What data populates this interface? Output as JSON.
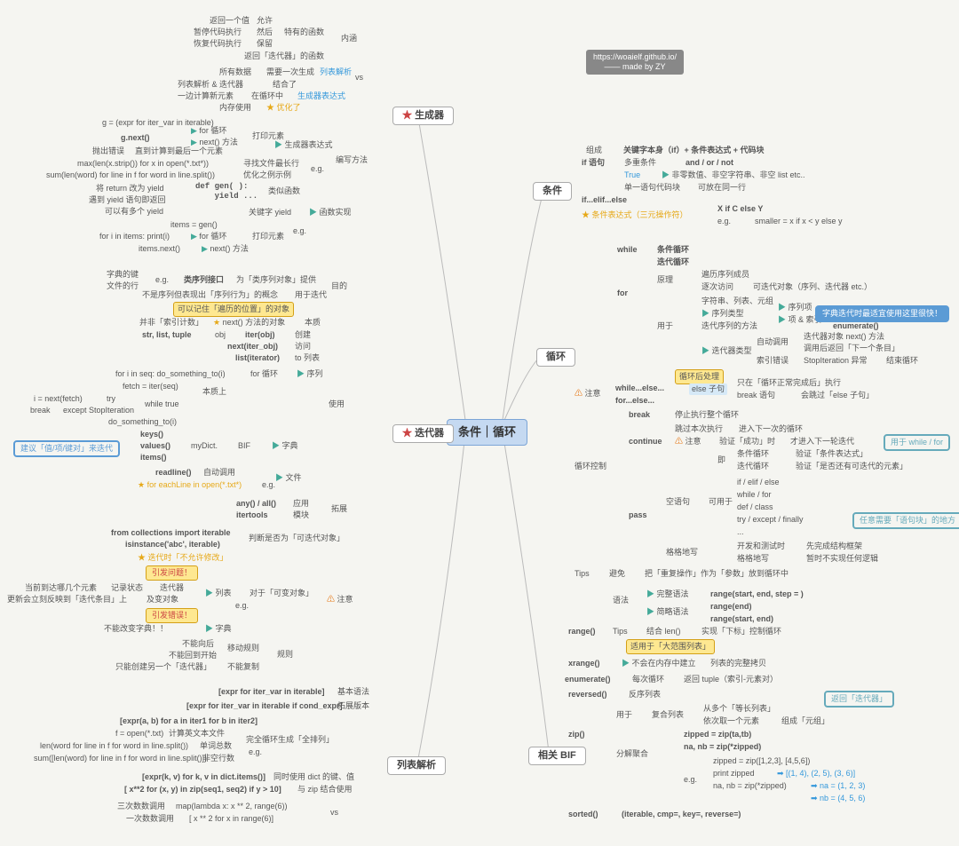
{
  "central": "条件｜循环",
  "credit": {
    "l1": "https://woaielf.github.io/",
    "l2": "—— made by ZY"
  },
  "cats": {
    "gen": "生成器",
    "iter": "迭代器",
    "list": "列表解析",
    "cond": "条件",
    "loop": "循环",
    "bif": "相关 BIF"
  },
  "gen": {
    "ret": "返回一个值",
    "allow": "允许",
    "pause": "暂停代码执行",
    "then": "然后",
    "spec": "特有的函数",
    "resume": "恢复代码执行",
    "keep": "保留",
    "neirun": "内涵",
    "retlist": "返回「迭代器」的函数",
    "all": "所有数据",
    "once": "需要一次生成",
    "listp": "列表解析",
    "parse": "列表解析 & 迭代器",
    "comb": "结合了",
    "vs": "vs",
    "onecalc": "一边计算新元素",
    "inloop": "在循环中",
    "genexpr": "生成器表达式",
    "mem": "内存使用",
    "opt": "★ 优化了",
    "gexpr": "g = (expr for iter_var in iterable)",
    "gnext": "g.next()",
    "forloop": "for 循环",
    "nextm": "next() 方法",
    "print": "打印元素",
    "throw": "抛出错误",
    "tolast": "直到计算到最后一个元素",
    "genexprn": "生成器表达式",
    "maxlen": "max(len(x.strip()) for x in open(*.txt*))",
    "findmax": "寻找文件最长行",
    "eg": "e.g.",
    "sumlen": "sum(len(word) for line in f for word in line.split())",
    "optex": "优化之例示例",
    "writem": "编写方法",
    "retyield": "将 return 改为 yield",
    "defgen": "def gen( ):\\n    yield ...",
    "likefn": "类似函数",
    "yieldret": "遇到 yield 语句即返回",
    "multy": "可以有多个 yield",
    "kwyield": "关键字 yield",
    "fnimp": "函数实现",
    "items": "items = gen()",
    "fori": "for i in items: print(i)",
    "foriter": "for 循环",
    "printel": "打印元素",
    "itemsnext": "items.next()",
    "nextmm": "next() 方法"
  },
  "iter": {
    "dictk": "字典的键",
    "fileline": "文件的行",
    "eg": "e.g.",
    "seqif": "类序列接口",
    "forseq": "为「类序列对象」提供",
    "purpose": "目的",
    "notseq": "不是序列但表现出「序列行为」的概念",
    "useiter": "用于迭代",
    "remember": "可以记住「遍历的位置」的对象",
    "noidx": "并非「索引计数」",
    "nextobj": "next() 方法的对象",
    "essence": "本质",
    "types": "str, list, tuple",
    "obj": "obj",
    "iterobj": "iter(obj)",
    "create": "创建",
    "nextiter": "next(iter_obj)",
    "visit": "访问",
    "listiter": "list(iterator)",
    "tolist": "to 列表",
    "forseq2": "for i in seq: do_something_to(i)",
    "forloop": "for 循环",
    "seq": "序列",
    "fetch": "fetch = iter(seq)",
    "ess2": "本质上",
    "inext": "i = next(fetch)",
    "try": "try",
    "whiletrue": "while true",
    "use": "使用",
    "break": "break",
    "except": "except StopIteration",
    "dosth": "do_something_to(i)",
    "keys": "keys()",
    "values": "values()",
    "items": "items()",
    "mydict": "myDict.",
    "bif": "BIF",
    "dict": "字典",
    "readline": "readline()",
    "autocall": "自动调用",
    "file": "文件",
    "foreach": "★ for eachLine in open(*.txt*)",
    "eg2": "e.g.",
    "anyall": "any() / all()",
    "apply": "应用",
    "itertools": "itertools",
    "module": "模块",
    "extend": "拓展",
    "fromcol": "from collections import iterable",
    "isinst": "isinstance('abc', iterable)",
    "judge": "判断是否为「可迭代对象」",
    "iternomod": "★ 迭代时「不允许修改」",
    "problem": "引发问题！",
    "seehow": "当前到达哪几个元素",
    "recstate": "记录状态",
    "iterator": "迭代器",
    "list": "列表",
    "forvar": "对于「可变对象」",
    "newadd": "更新会立刻反映到「迭代条目」上",
    "onfly": "及变对象",
    "note": "注意",
    "eg3": "e.g.",
    "error": "引发错误！",
    "nomod": "不能改变字典！！",
    "dict2": "字典",
    "nomove": "不能向后",
    "moverule": "移动规则",
    "rule": "规则",
    "noback": "不能回到开始",
    "onlyone": "只能创建另一个「迭代器」",
    "nocopy": "不能复制",
    "recommend": "建议「值/项/键对」来迭代"
  },
  "list": {
    "basic": "[expr for iter_var in iterable]",
    "basicv": "基本语法",
    "cond": "[expr for iter_var in iterable if cond_expr]",
    "condv": "拓展版本",
    "nest": "[expr(a, b) for a in iter1 for b in iter2]",
    "fopen": "f = open(*.txt)",
    "calc": "计算英文本文件",
    "fullge": "完全循环生成「全排列」",
    "lenword": "len(word for line in f for word in line.split())",
    "wordcnt": "单词总数",
    "eg": "e.g.",
    "sumword": "sum([len(word) for line in f for word in line.split()])",
    "nonempty": "非空行数",
    "dictkv": "[expr(k, v) for k, v in dict.items()]",
    "usedict": "同时使用 dict 的键、值",
    "zip": "[ x**2 for (x, y) in zip(seq1, seq2) if y > 10]",
    "zipuse": "与 zip 结合使用",
    "map": "三次数数调用",
    "maplam": "map(lambda x: x ** 2, range(6))",
    "vs": "vs",
    "one": "一次数数调用",
    "onelam": "[ x ** 2 for x in range(6)]"
  },
  "cond": {
    "compose": "组成",
    "kw": "关键字本身（if）+ 条件表达式 + 代码块",
    "if": "if 语句",
    "multi": "多重条件",
    "andor": "and / or / not",
    "true": "True",
    "nonzero": "非零数值、非空字符串、非空 list etc..",
    "single": "单一语句代码块",
    "sameline": "可放在同一行",
    "elif": "if...elif...else",
    "ternary": "★ 条件表达式（三元操作符）",
    "xify": "X if C else Y",
    "eg": "e.g.",
    "smaller": "smaller = x if x < y else y"
  },
  "loop": {
    "while": "while",
    "condloop": "条件循环",
    "iterloop": "迭代循环",
    "principle": "原理",
    "iterseq": "遍历序列成员",
    "eachvisit": "逐次访问",
    "iterable": "可迭代对象（序列、迭代器 etc.）",
    "for": "for",
    "strtuple": "字符串、列表、元组",
    "seqtype": "序列类型",
    "byseq": "序列项",
    "iterseqm": "迭代序列的方法",
    "idx": "项 & 索引",
    "enum": "enumerate()",
    "usedfor": "用于",
    "itertype": "迭代器类型",
    "autocall": "自动调用",
    "nextm": "迭代器对象 next() 方法",
    "callret": "调用后返回「下一个条目」",
    "idxerr": "索引错误",
    "stopiter": "StopIteration 异常",
    "endloop": "结束循环",
    "afterloop": "循环后处理",
    "note": "注意",
    "whileelse": "while...else...",
    "forelse": "for...else...",
    "else": "else 子句",
    "onlynorm": "只在「循环正常完成后」执行",
    "breakstmt": "break 语句",
    "skip": "会跳过「else 子句」",
    "break": "break",
    "stopall": "停止执行整个循环",
    "skipthis": "跳过本次执行",
    "next": "进入下一次的循环",
    "continue": "continue",
    "note2": "注意",
    "verify": "验证「成功」时",
    "thennext": "才进入下一轮迭代",
    "condloop2": "条件循环",
    "verifycond": "验证「条件表达式」",
    "iterloop2": "迭代循环",
    "verifyiter": "验证「是否还有可迭代的元素」",
    "loopctrl": "循环控制",
    "ifelif": "if / elif / else",
    "whilefor": "while / for",
    "defclass": "def / class",
    "tryex": "try / except / finally",
    "dots": "...",
    "empty": "空语句",
    "canuse": "可用于",
    "pass": "pass",
    "devtest": "开发和测试时",
    "fillstruct": "先完成结构框架",
    "getback": "格格地写",
    "defer": "暂时不实现任何逻辑",
    "tips": "Tips",
    "avoid": "避免",
    "reop": "把「重复操作」作为「参数」放到循环中",
    "usewhile": "用于 while / for",
    "arbcode": "任意需要「语句块」的地方",
    "dictiter": "字典迭代时最适宜使用这里很快！"
  },
  "bif": {
    "lang": "语法",
    "full": "完整语法",
    "rangefull": "range(start, end, step = )",
    "simple": "简略语法",
    "rangeend": "range(end)",
    "rangese": "range(start, end)",
    "range": "range()",
    "tips": "Tips",
    "withlen": "结合 len()",
    "subctrl": "实现「下标」控制循环",
    "biglist": "适用于「大范围列表」",
    "xrange": "xrange()",
    "nomem": "不会在内存中建立",
    "fullcopy": "列表的完整拷贝",
    "enum": "enumerate()",
    "eachloop": "每次循环",
    "rettuple": "返回 tuple（索引-元素对）",
    "reversed": "reversed()",
    "revseq": "反序列表",
    "usedfor": "用于",
    "compseq": "复合列表",
    "frommany": "从多个「等长列表」",
    "byidx": "依次取一个元素",
    "tuple": "组成「元组」",
    "zip": "zip()",
    "decomp": "分解聚合",
    "zipab": "zipped = zip(ta,tb)",
    "naab": "na, nb = zip(*zipped)",
    "zipex": "zipped = zip([1,2,3], [4,5,6])",
    "printz": "print zipped",
    "zipres": "[(1, 4), (2, 5), (3, 6)]",
    "eg": "e.g.",
    "nanb": "na, nb = zip(*zipped)",
    "na": "na = (1, 2, 3)",
    "nb": "nb = (4, 5, 6)",
    "sorted": "sorted()",
    "sortsig": "(iterable, cmp=, key=, reverse=)",
    "retiter": "返回「迭代器」"
  }
}
